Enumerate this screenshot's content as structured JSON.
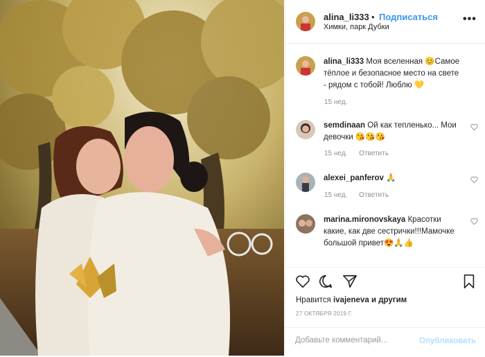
{
  "post": {
    "username": "alina_li333",
    "follow_label": "Подписаться",
    "location": "Химки, парк Дубки",
    "more_label": "•••"
  },
  "caption": {
    "username": "alina_li333",
    "text": "Моя вселенная 😊Самое тёплое и безопасное место на свете - рядом с тобой! Люблю 💛",
    "time": "15 нед."
  },
  "comments": [
    {
      "username": "semdinaan",
      "text": "Ой как тепленько... Мои девочки 😘😘😘",
      "time": "15 нед.",
      "reply": "Ответить"
    },
    {
      "username": "alexei_panferov",
      "text": "🙏",
      "time": "15 нед.",
      "reply": "Ответить"
    },
    {
      "username": "marina.mironovskaya",
      "text": "Красотки какие, как две сестрички!!!Мамочке большой привет😍🙏👍",
      "time": "",
      "reply": ""
    }
  ],
  "likes": {
    "prefix": "Нравится",
    "user": "ivajeneva",
    "suffix": "и другим"
  },
  "date": "27 ОКТЯБРЯ 2019 Г.",
  "add_comment": {
    "placeholder": "Добавьте комментарий...",
    "publish_label": "Опубликовать"
  },
  "colors": {
    "accent": "#3897f0",
    "publish_disabled": "#b2dffc",
    "muted": "#8e8e8e"
  },
  "icons": [
    "more-icon",
    "heart-icon",
    "comment-icon",
    "share-icon",
    "bookmark-icon"
  ]
}
